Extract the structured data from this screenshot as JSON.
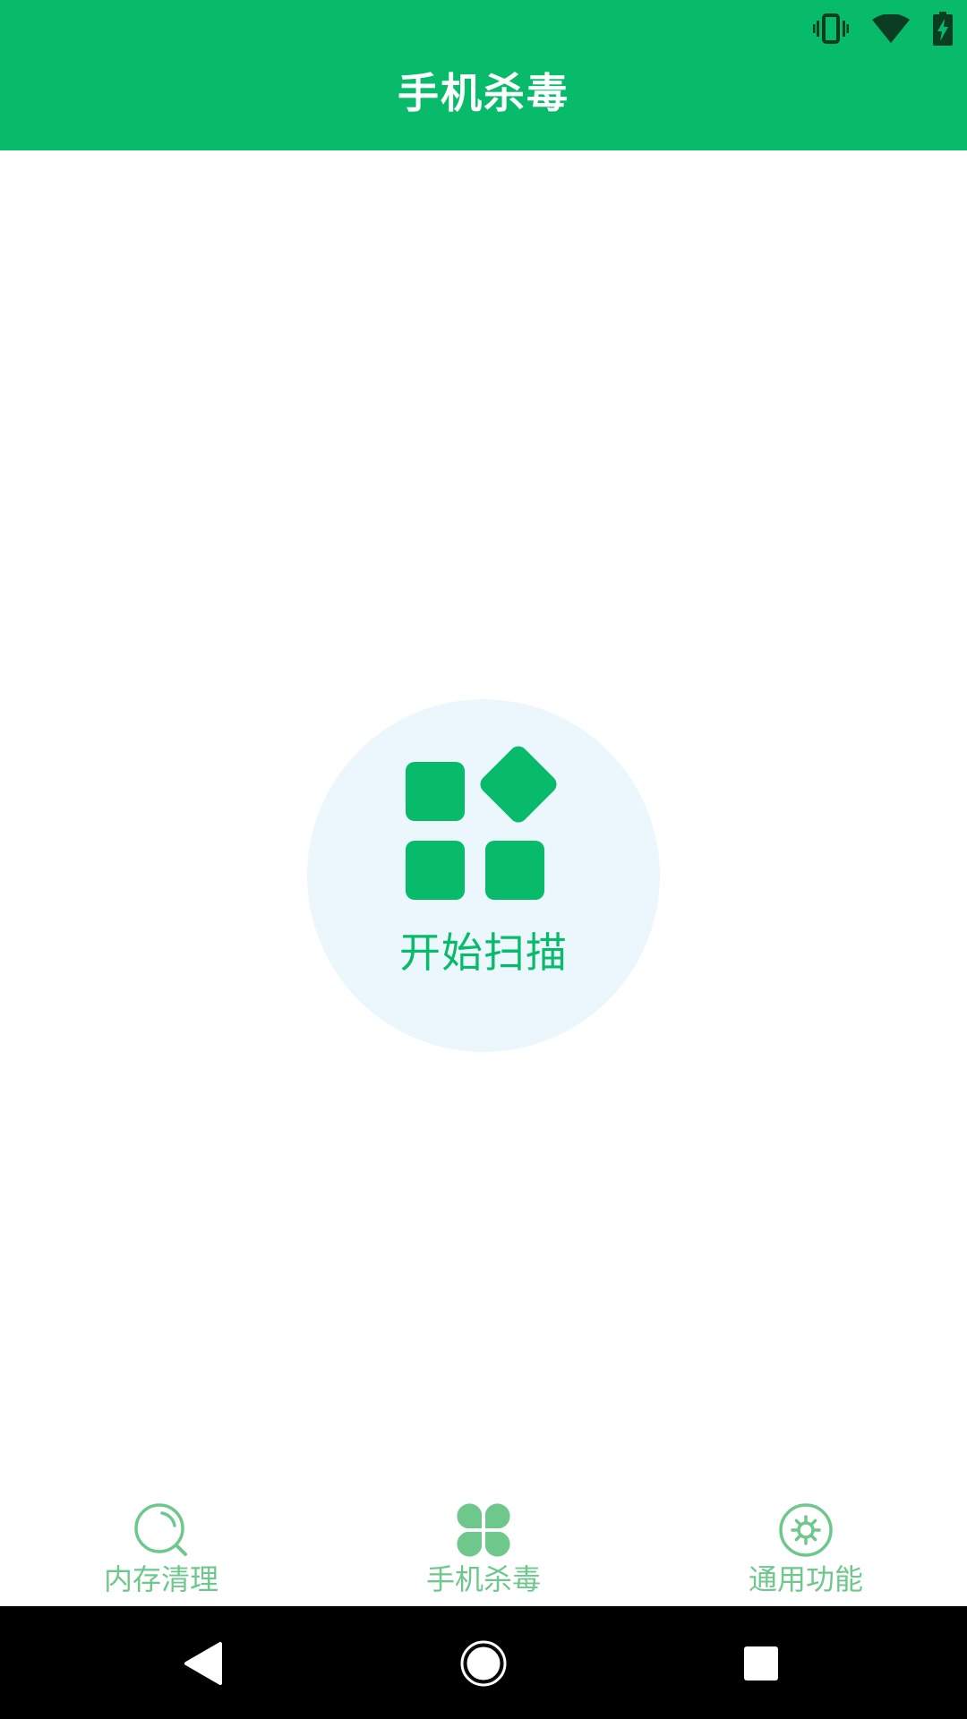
{
  "app": {
    "title": "手机杀毒",
    "accent_color": "#08bb6a"
  },
  "status_bar": {
    "icons": [
      "vibrate-icon",
      "wifi-icon",
      "battery-charging-icon"
    ]
  },
  "scan": {
    "label": "开始扫描",
    "icon": "apps-grid-icon",
    "background_color": "#ebf7fd"
  },
  "bottom_nav": {
    "items": [
      {
        "label": "内存清理",
        "icon": "search-clean-icon"
      },
      {
        "label": "手机杀毒",
        "icon": "clover-icon"
      },
      {
        "label": "通用功能",
        "icon": "gear-icon"
      }
    ],
    "color": "#6fc88b"
  },
  "system_nav": {
    "buttons": [
      "back-icon",
      "home-icon",
      "recents-icon"
    ]
  }
}
